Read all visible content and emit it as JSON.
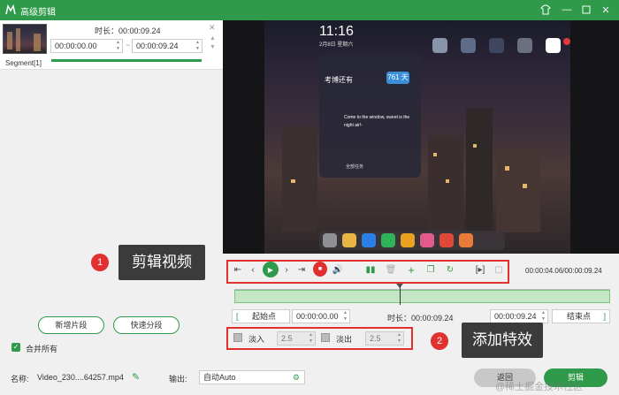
{
  "window": {
    "title": "高级剪辑"
  },
  "segment": {
    "name": "Segment[1]",
    "duration_label": "时长：00:00:09.24",
    "start": "00:00:00.00",
    "end": "00:00:09.24"
  },
  "left_actions": {
    "new_segment": "新增片段",
    "quick_split": "快速分段",
    "merge_all": "合并所有"
  },
  "phone": {
    "clock": "11:16",
    "date": "2月8日 星期六",
    "widget_title": "考博还有",
    "widget_days": "761",
    "widget_unit": "天",
    "widget_quote": "Come to the window, sweet is the night air!-",
    "widget_all": "全部任务"
  },
  "player": {
    "time": "00:00:04.06/00:00:09.24",
    "progress_fraction": 0.44
  },
  "range": {
    "start_btn": "起始点",
    "start_time": "00:00:00.00",
    "duration": "时长：00:00:09.24",
    "end_time": "00:00:09.24",
    "end_btn": "结束点"
  },
  "effects": {
    "fade_in_label": "淡入",
    "fade_in_value": "2.5",
    "fade_out_label": "淡出",
    "fade_out_value": "2.5"
  },
  "annotations": {
    "num1": "1",
    "text1": "剪辑视频",
    "num2": "2",
    "text2": "添加特效"
  },
  "bottom": {
    "name_label": "名称:",
    "file_name": "Video_230....64257.mp4",
    "output_label": "输出:",
    "output_value": "自动Auto",
    "back": "返回",
    "clip": "剪辑"
  },
  "watermark": "@稀土掘金技术社区",
  "colors": {
    "accent": "#2e9a4a",
    "callout": "#e03030"
  }
}
